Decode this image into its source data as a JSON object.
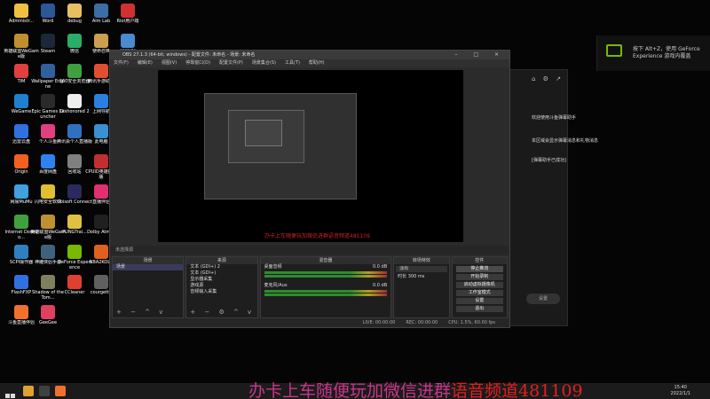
{
  "desktop": {
    "icons": [
      {
        "label": "Administr...",
        "color": "#f0c040"
      },
      {
        "label": "Word",
        "color": "#2b5797"
      },
      {
        "label": "debug",
        "color": "#e8c060"
      },
      {
        "label": "Aim Lab",
        "color": "#3a6ea5"
      },
      {
        "label": "Riot用户端",
        "color": "#d03030"
      },
      {
        "label": "英雄联盟WeGame版",
        "color": "#c09030"
      },
      {
        "label": "Steam",
        "color": "#1b2838"
      },
      {
        "label": "微信",
        "color": "#2aae67"
      },
      {
        "label": "使命召唤",
        "color": "#caa050"
      },
      {
        "label": "网易UU",
        "color": "#4a8ad0"
      },
      {
        "label": "TIM",
        "color": "#e04040"
      },
      {
        "label": "Wallpaper Engine",
        "color": "#3060a0"
      },
      {
        "label": "360安全浏览器",
        "color": "#40a040"
      },
      {
        "label": "腾讯手游助手",
        "color": "#e05030"
      },
      {
        "label": "QQ浏览器",
        "color": "#3090e0"
      },
      {
        "label": "WeGame",
        "color": "#2080d0"
      },
      {
        "label": "Epic Games Launcher",
        "color": "#2a2a2a"
      },
      {
        "label": "Dishonored 2",
        "color": "#eeeeee"
      },
      {
        "label": "上网导航",
        "color": "#2a80e0"
      },
      {
        "label": "腾讯QQ",
        "color": "#1e90ff"
      },
      {
        "label": "迅雷云盘",
        "color": "#3070e0"
      },
      {
        "label": "个人斗鱼",
        "color": "#e04080"
      },
      {
        "label": "腾讯会个人直播版",
        "color": "#3070c0"
      },
      {
        "label": "此电脑",
        "color": "#3a90d0"
      },
      {
        "label": "Counter-Strike Global Off...",
        "color": "#e0a020"
      },
      {
        "label": "Origin",
        "color": "#f06020"
      },
      {
        "label": "百度网盘",
        "color": "#3080f0"
      },
      {
        "label": "回收站",
        "color": "#808080"
      },
      {
        "label": "CPUID英雄技术版",
        "color": "#c03030"
      },
      {
        "label": "天翼云盘",
        "color": "#3060c0"
      },
      {
        "label": "网易MuMu",
        "color": "#40a0e0"
      },
      {
        "label": "闪电安全软件",
        "color": "#e0c030"
      },
      {
        "label": "Ubisoft Connect",
        "color": "#2a2a60"
      },
      {
        "label": "直播伴侣",
        "color": "#e03070"
      },
      {
        "label": "OBS Studio",
        "color": "#303030"
      },
      {
        "label": "Internet Downlo...",
        "color": "#40a040"
      },
      {
        "label": "英雄联盟WeGame版",
        "color": "#c09030"
      },
      {
        "label": "PUNGTrai...",
        "color": "#e0c040"
      },
      {
        "label": "Dolby Atmos",
        "color": "#202020"
      },
      {
        "label": "英雄联盟",
        "color": "#c09030"
      },
      {
        "label": "SCPI操作器",
        "color": "#3080c0"
      },
      {
        "label": "神雕侠侣手游",
        "color": "#406080"
      },
      {
        "label": "GeForce Experience",
        "color": "#76b900"
      },
      {
        "label": "NBA2KOL2",
        "color": "#e06020"
      },
      {
        "label": "微门ICQ",
        "color": "#e0e0e0"
      },
      {
        "label": "FlashFXP",
        "color": "#3070e0"
      },
      {
        "label": "Shadow of the Tom...",
        "color": "#808060"
      },
      {
        "label": "CCleaner",
        "color": "#e04030"
      },
      {
        "label": "courgette",
        "color": "#606060"
      },
      {
        "label": "网易云音乐",
        "color": "#d03030"
      },
      {
        "label": "斗鱼直播伴侣",
        "color": "#f07030"
      },
      {
        "label": "GeeGee",
        "color": "#e04060"
      }
    ]
  },
  "nvidia": {
    "line1": "按下 Alt+Z，使用 GeForce",
    "line2": "Experience 游戏内覆盖"
  },
  "douyu_panel": {
    "messages": [
      "欢迎使用斗鱼弹幕助手",
      "本区域会显示弹幕消息和礼物消息",
      "[弹幕助手已成功]"
    ],
    "pill": "设置"
  },
  "obs": {
    "title": "OBS 27.1.3 (64-bit, windows) - 配置文件: 未命名 - 场景: 未命名",
    "menu": [
      "文件(F)",
      "编辑(E)",
      "视图(V)",
      "停靠窗口(D)",
      "配置文件(P)",
      "场景集合(S)",
      "工具(T)",
      "帮助(H)"
    ],
    "preview_text": "办卡上车随便玩加微信进群语音频道481109",
    "toolbar": "未选择源",
    "docks": {
      "scenes": {
        "header": "场景",
        "items": [
          "场景"
        ]
      },
      "sources": {
        "header": "来源",
        "items": [
          "文本 (GDI+) 2",
          "文本 (GDI+)",
          "显示器采集",
          "游戏源",
          "音频输入采集"
        ]
      },
      "mixer": {
        "header": "混音器",
        "items": [
          "桌面音频",
          "麦克风/Aux"
        ],
        "levels": [
          "0.0 dB",
          "0.0 dB"
        ]
      },
      "transitions": {
        "header": "转场特效",
        "type": "淡出",
        "duration_label": "时长",
        "duration": "300 ms"
      },
      "controls": {
        "header": "控件",
        "buttons": [
          "停止推流",
          "开始录制",
          "启动虚拟摄像机",
          "工作室模式",
          "设置",
          "退出"
        ]
      }
    },
    "status": {
      "live": "LIVE: 00:00:00",
      "rec": "REC: 00:00:00",
      "cpu": "CPU: 1.5%, 60.00 fps"
    }
  },
  "overlay": {
    "part_a": "办卡上车随便玩加微信进群",
    "part_b": "语音频道481109"
  },
  "taskbar": {
    "apps": [
      {
        "name": "explorer",
        "color": "#e0a030"
      },
      {
        "name": "obs",
        "color": "#404040"
      },
      {
        "name": "douyu",
        "color": "#f07030"
      }
    ],
    "time": "15:40",
    "date": "2022/1/1"
  }
}
